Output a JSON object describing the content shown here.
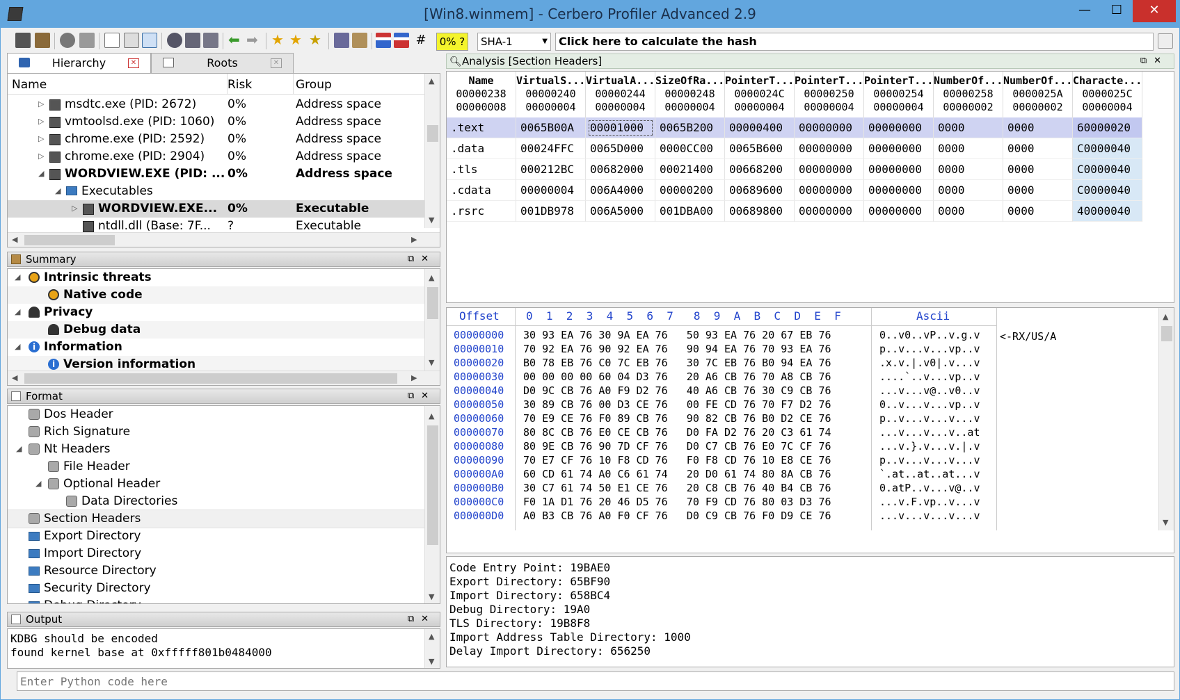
{
  "window": {
    "title": "[Win8.winmem] - Cerbero Profiler Advanced 2.9",
    "min": "—",
    "max": "☐",
    "close": "✕"
  },
  "toolbar": {
    "percent": "0% ?",
    "hash_algo": "SHA-1",
    "hash_button": "Click here to calculate the hash"
  },
  "tabs": [
    {
      "label": "Hierarchy"
    },
    {
      "label": "Roots"
    }
  ],
  "hierarchy": {
    "columns": [
      "Name",
      "Risk",
      "Group"
    ],
    "rows": [
      {
        "name": "msdtc.exe (PID: 2672)",
        "risk": "0%",
        "group": "Address space"
      },
      {
        "name": "vmtoolsd.exe (PID: 1060)",
        "risk": "0%",
        "group": "Address space"
      },
      {
        "name": "chrome.exe (PID: 2592)",
        "risk": "0%",
        "group": "Address space"
      },
      {
        "name": "chrome.exe (PID: 2904)",
        "risk": "0%",
        "group": "Address space"
      },
      {
        "name": "WORDVIEW.EXE (PID: ...",
        "risk": "0%",
        "group": "Address space"
      },
      {
        "name": "Executables",
        "risk": "",
        "group": ""
      },
      {
        "name": "WORDVIEW.EXE...",
        "risk": "0%",
        "group": "Executable"
      },
      {
        "name": "ntdll.dll (Base: 7F...",
        "risk": "?",
        "group": "Executable"
      }
    ]
  },
  "summary": {
    "title": "Summary",
    "items": [
      {
        "label": "Intrinsic threats",
        "icon": "biohazard-icon"
      },
      {
        "label": "Native code",
        "icon": "biohazard-icon"
      },
      {
        "label": "Privacy",
        "icon": "user-icon"
      },
      {
        "label": "Debug data",
        "icon": "user-icon"
      },
      {
        "label": "Information",
        "icon": "info-icon"
      },
      {
        "label": "Version information",
        "icon": "info-icon"
      }
    ]
  },
  "format": {
    "title": "Format",
    "items": [
      {
        "label": "Dos Header"
      },
      {
        "label": "Rich Signature"
      },
      {
        "label": "Nt Headers"
      },
      {
        "label": "File Header"
      },
      {
        "label": "Optional Header"
      },
      {
        "label": "Data Directories"
      },
      {
        "label": "Section Headers"
      },
      {
        "label": "Export Directory"
      },
      {
        "label": "Import Directory"
      },
      {
        "label": "Resource Directory"
      },
      {
        "label": "Security Directory"
      },
      {
        "label": "Debug Directory"
      }
    ]
  },
  "output": {
    "title": "Output",
    "lines": [
      "KDBG should be encoded",
      "found kernel base at 0xfffff801b0484000"
    ],
    "input_placeholder": "Enter Python code here"
  },
  "analysis": {
    "title": "Analysis [Section Headers]",
    "columns": [
      {
        "name": "Name",
        "off": "00000238",
        "size": "00000008"
      },
      {
        "name": "VirtualS...",
        "off": "00000240",
        "size": "00000004"
      },
      {
        "name": "VirtualA...",
        "off": "00000244",
        "size": "00000004"
      },
      {
        "name": "SizeOfRa...",
        "off": "00000248",
        "size": "00000004"
      },
      {
        "name": "PointerT...",
        "off": "0000024C",
        "size": "00000004"
      },
      {
        "name": "PointerT...",
        "off": "00000250",
        "size": "00000004"
      },
      {
        "name": "PointerT...",
        "off": "00000254",
        "size": "00000004"
      },
      {
        "name": "NumberOf...",
        "off": "00000258",
        "size": "00000002"
      },
      {
        "name": "NumberOf...",
        "off": "0000025A",
        "size": "00000002"
      },
      {
        "name": "Characte...",
        "off": "0000025C",
        "size": "00000004"
      }
    ],
    "rows": [
      [
        ".text",
        "0065B00A",
        "00001000",
        "0065B200",
        "00000400",
        "00000000",
        "00000000",
        "0000",
        "0000",
        "60000020"
      ],
      [
        ".data",
        "00024FFC",
        "0065D000",
        "0000CC00",
        "0065B600",
        "00000000",
        "00000000",
        "0000",
        "0000",
        "C0000040"
      ],
      [
        ".tls",
        "000212BC",
        "00682000",
        "00021400",
        "00668200",
        "00000000",
        "00000000",
        "0000",
        "0000",
        "C0000040"
      ],
      [
        ".cdata",
        "00000004",
        "006A4000",
        "00000200",
        "00689600",
        "00000000",
        "00000000",
        "0000",
        "0000",
        "C0000040"
      ],
      [
        ".rsrc",
        "001DB978",
        "006A5000",
        "001DBA00",
        "00689800",
        "00000000",
        "00000000",
        "0000",
        "0000",
        "40000040"
      ]
    ]
  },
  "hex": {
    "header": {
      "offset": "Offset",
      "cols": "0  1  2  3  4  5  6  7   8  9  A  B  C  D  E  F",
      "ascii": "Ascii"
    },
    "annotation": "<-RX/US/A",
    "lines": [
      {
        "off": "00000000",
        "bytes": "30 93 EA 76 30 9A EA 76   50 93 EA 76 20 67 EB 76",
        "ascii": "0..v0..vP..v.g.v"
      },
      {
        "off": "00000010",
        "bytes": "70 92 EA 76 90 92 EA 76   90 94 EA 76 70 93 EA 76",
        "ascii": "p..v...v...vp..v"
      },
      {
        "off": "00000020",
        "bytes": "B0 78 EB 76 C0 7C EB 76   30 7C EB 76 B0 94 EA 76",
        "ascii": ".x.v.|.v0|.v...v"
      },
      {
        "off": "00000030",
        "bytes": "00 00 00 00 60 04 D3 76   20 A6 CB 76 70 A8 CB 76",
        "ascii": "....`..v...vp..v"
      },
      {
        "off": "00000040",
        "bytes": "D0 9C CB 76 A0 F9 D2 76   40 A6 CB 76 30 C9 CB 76",
        "ascii": "...v...v@..v0..v"
      },
      {
        "off": "00000050",
        "bytes": "30 89 CB 76 00 D3 CE 76   00 FE CD 76 70 F7 D2 76",
        "ascii": "0..v...v...vp..v"
      },
      {
        "off": "00000060",
        "bytes": "70 E9 CE 76 F0 89 CB 76   90 82 CB 76 B0 D2 CE 76",
        "ascii": "p..v...v...v...v"
      },
      {
        "off": "00000070",
        "bytes": "80 8C CB 76 E0 CE CB 76   D0 FA D2 76 20 C3 61 74",
        "ascii": "...v...v...v..at"
      },
      {
        "off": "00000080",
        "bytes": "80 9E CB 76 90 7D CF 76   D0 C7 CB 76 E0 7C CF 76",
        "ascii": "...v.}.v...v.|.v"
      },
      {
        "off": "00000090",
        "bytes": "70 E7 CF 76 10 F8 CD 76   F0 F8 CD 76 10 E8 CE 76",
        "ascii": "p..v...v...v...v"
      },
      {
        "off": "000000A0",
        "bytes": "60 CD 61 74 A0 C6 61 74   20 D0 61 74 80 8A CB 76",
        "ascii": "`.at..at..at...v"
      },
      {
        "off": "000000B0",
        "bytes": "30 C7 61 74 50 E1 CE 76   20 C8 CB 76 40 B4 CB 76",
        "ascii": "0.atP..v...v@..v"
      },
      {
        "off": "000000C0",
        "bytes": "F0 1A D1 76 20 46 D5 76   70 F9 CD 76 80 03 D3 76",
        "ascii": "...v.F.vp..v...v"
      },
      {
        "off": "000000D0",
        "bytes": "A0 B3 CB 76 A0 F0 CF 76   D0 C9 CB 76 F0 D9 CE 76",
        "ascii": "...v...v...v...v"
      }
    ]
  },
  "info": {
    "lines": [
      "Code Entry Point: 19BAE0",
      "Export Directory: 65BF90",
      "Import Directory: 658BC4",
      "Debug Directory: 19A0",
      "TLS Directory: 19B8F8",
      "Import Address Table Directory: 1000",
      "Delay Import Directory: 656250"
    ]
  }
}
